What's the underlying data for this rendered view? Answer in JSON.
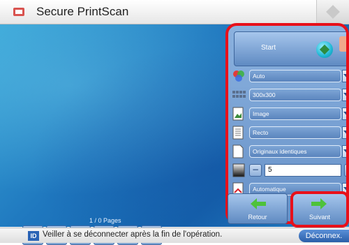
{
  "app": {
    "title": "Secure PrintScan"
  },
  "preview": {
    "page_counter": "1 / 0 Pages"
  },
  "nav_buttons": [
    {
      "icon": "double-left-arrow-icon"
    },
    {
      "icon": "page-view-icon"
    },
    {
      "icon": "pages-view-icon"
    },
    {
      "icon": "delete-page-icon"
    },
    {
      "icon": "insert-page-icon"
    },
    {
      "icon": "double-right-arrow-icon"
    }
  ],
  "panel": {
    "start_label": "Start",
    "options": {
      "color": "Auto",
      "resolution": "300x300",
      "original_type": "Image",
      "sides": "Recto",
      "originals": "Originaux identiques",
      "copies": "5",
      "paper": "Automatique"
    }
  },
  "footer_buttons": {
    "retour": "Retour",
    "suivant": "Suivant"
  },
  "status": {
    "badge": "ID",
    "message": "Veiller à se déconnecter après la fin de l'opération.",
    "logout": "Déconnex."
  },
  "colors": {
    "accent_red": "#e8101a",
    "panel_blue": "#6690c7",
    "arrow_green": "#4ec23a"
  }
}
